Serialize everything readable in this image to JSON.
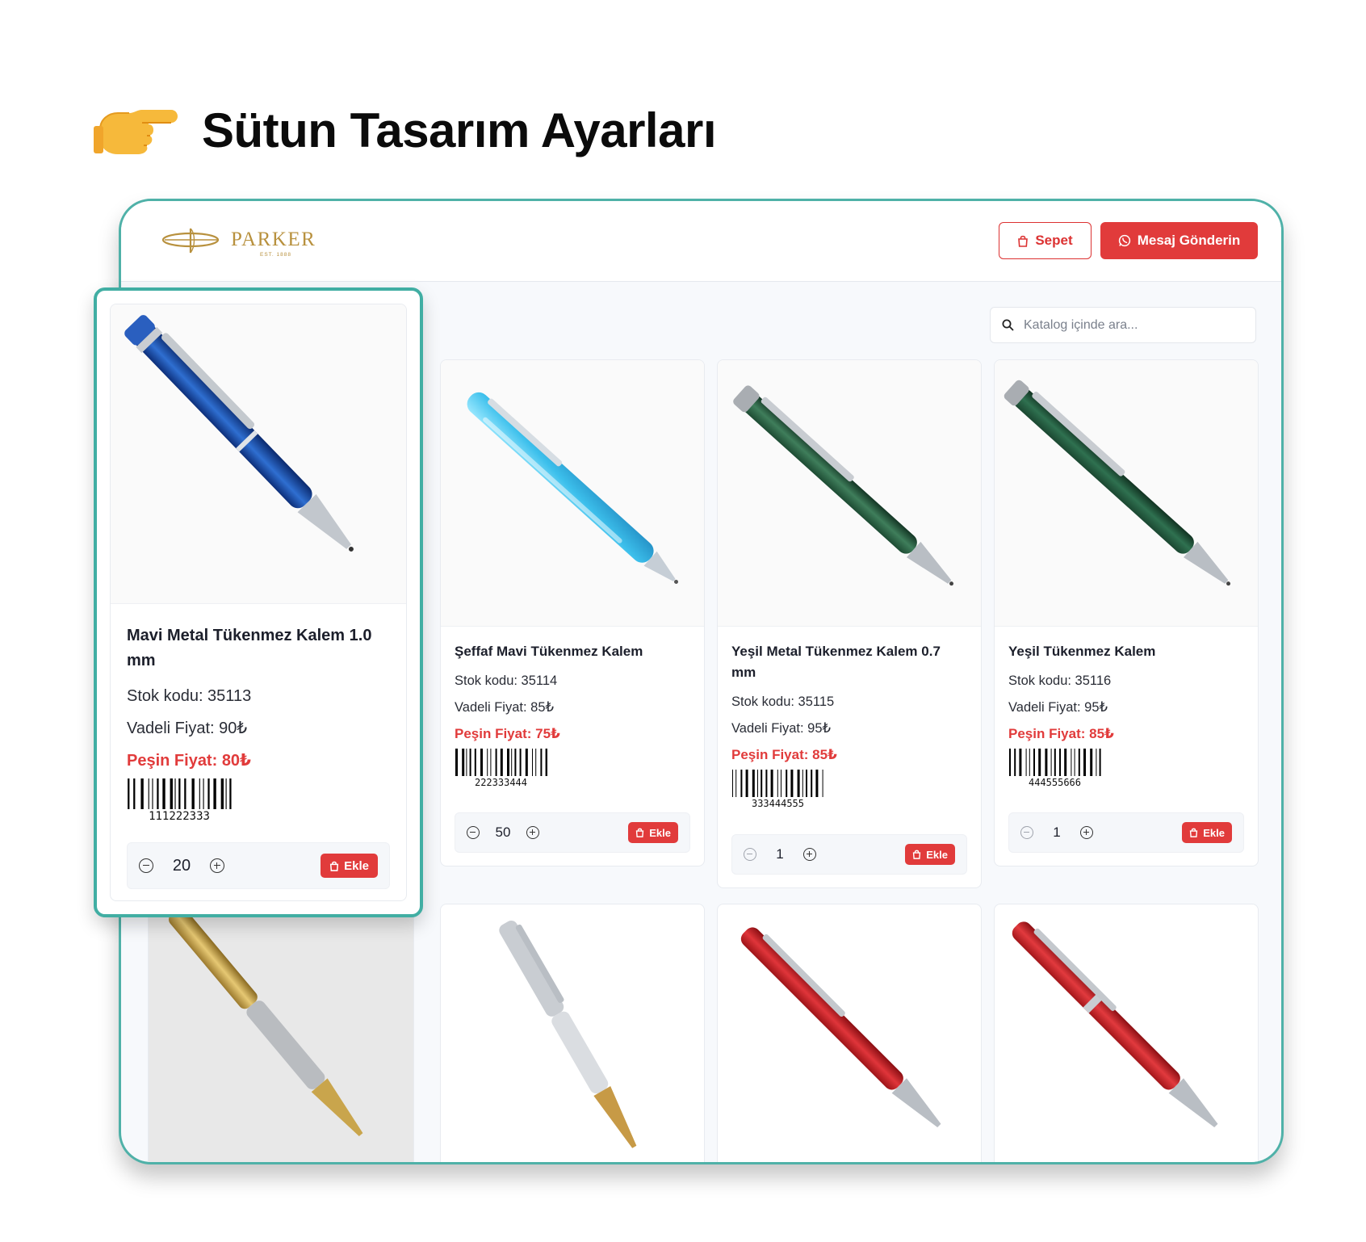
{
  "heading": {
    "icon": "pointing-hand-icon",
    "title": "Sütun Tasarım Ayarları"
  },
  "header": {
    "brand": "PARKER",
    "brand_sub": "EST. 1888",
    "cart_label": "Sepet",
    "cart_icon": "shopping-bag-icon",
    "message_label": "Mesaj Gönderin",
    "message_icon": "whatsapp-icon",
    "accent_color": "#e13b3b",
    "frame_color": "#4fb1a8"
  },
  "search": {
    "placeholder": "Katalog içinde ara..."
  },
  "highlighted": {
    "name": "Mavi Metal Tükenmez Kalem 1.0 mm",
    "stock": "Stok kodu: 35113",
    "deferred": "Vadeli Fiyat: 90₺",
    "cash": "Peşin Fiyat: 80₺",
    "barcode": "111222333",
    "qty": "20",
    "add_label": "Ekle",
    "pen_color": "blue"
  },
  "products": [
    {
      "name": "Şeffaf Mavi Tükenmez Kalem",
      "stock": "Stok kodu: 35114",
      "deferred": "Vadeli Fiyat: 85₺",
      "cash": "Peşin Fiyat: 75₺",
      "barcode": "222333444",
      "qty": "50",
      "add_label": "Ekle",
      "pen_color": "clear-blue"
    },
    {
      "name": "Yeşil Metal Tükenmez Kalem 0.7 mm",
      "stock": "Stok kodu: 35115",
      "deferred": "Vadeli Fiyat: 95₺",
      "cash": "Peşin Fiyat: 85₺",
      "barcode": "333444555",
      "qty": "1",
      "add_label": "Ekle",
      "pen_color": "green"
    },
    {
      "name": "Yeşil Tükenmez Kalem",
      "stock": "Stok kodu: 35116",
      "deferred": "Vadeli Fiyat: 95₺",
      "cash": "Peşin Fiyat: 85₺",
      "barcode": "444555666",
      "qty": "1",
      "add_label": "Ekle",
      "pen_color": "green"
    }
  ],
  "second_row": [
    {
      "pen_color": "gold"
    },
    {
      "pen_color": "silver-gold"
    },
    {
      "pen_color": "red"
    },
    {
      "pen_color": "red"
    }
  ]
}
